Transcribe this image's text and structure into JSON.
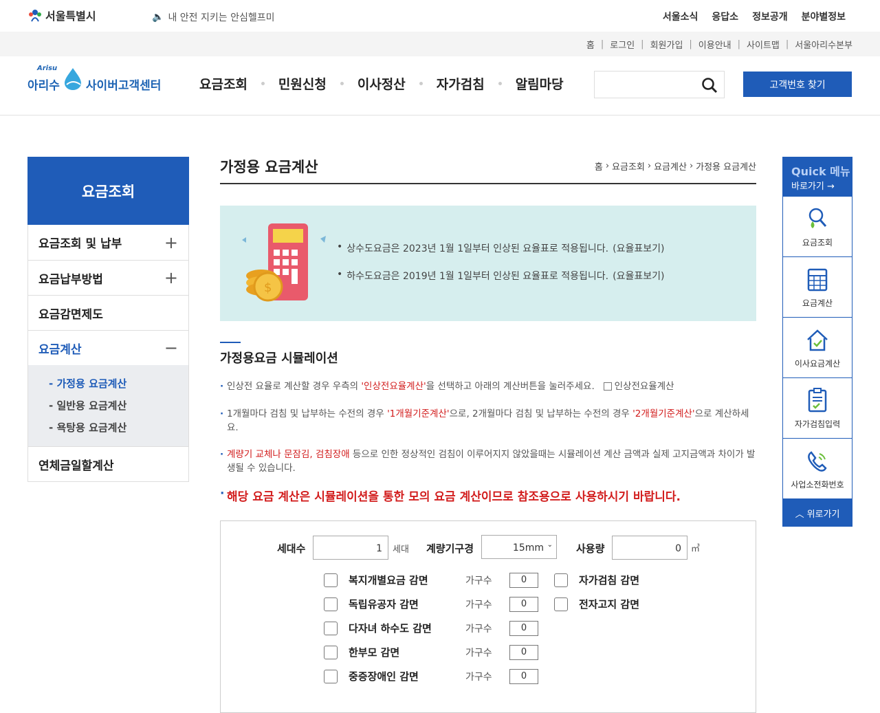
{
  "header": {
    "seoul_logo": "서울특별시",
    "slogan": "내 안전 지키는 안심헬프미",
    "top_nav": [
      "서울소식",
      "응답소",
      "정보공개",
      "분야별정보"
    ],
    "util_nav": [
      "홈",
      "로그인",
      "회원가입",
      "이용안내",
      "사이트맵",
      "서울아리수본부"
    ],
    "arisu_small": "Arisu",
    "arisu_name": "아리수",
    "arisu_center": "사이버고객센터",
    "gnb": [
      "요금조회",
      "민원신청",
      "이사정산",
      "자가검침",
      "알림마당"
    ],
    "search_placeholder": "",
    "find_button": "고객번호 찾기"
  },
  "lnb": {
    "title": "요금조회",
    "items": [
      {
        "label": "요금조회 및 납부",
        "toggle": "+"
      },
      {
        "label": "요금납부방법",
        "toggle": "+"
      },
      {
        "label": "요금감면제도",
        "toggle": ""
      },
      {
        "label": "요금계산",
        "toggle": "−"
      },
      {
        "label": "연체금일할계산",
        "toggle": ""
      }
    ],
    "sub_items": [
      "- 가정용 요금계산",
      "- 일반용 요금계산",
      "- 욕탕용 요금계산"
    ]
  },
  "content": {
    "title": "가정용 요금계산",
    "breadcrumb": [
      "홈",
      "요금조회",
      "요금계산",
      "가정용 요금계산"
    ],
    "notice_lines": [
      {
        "text": "상수도요금은 2023년 1월 1일부터 인상된 요율표로 적용됩니다.",
        "link": "(요율표보기)"
      },
      {
        "text": "하수도요금은 2019년 1월 1일부터 인상된 요율표로 적용됩니다.",
        "link": "(요율표보기)"
      }
    ],
    "section_title": "가정용요금 시뮬레이션",
    "desc1_a": "인상전 요율로 계산할 경우 우측의 ",
    "desc1_red": "'인상전요율계산'",
    "desc1_b": "을 선택하고 아래의 계산버튼을 눌러주세요.",
    "desc1_checkbox": "인상전요율계산",
    "desc2_a": "1개월마다 검침 및 납부하는 수전의 경우 ",
    "desc2_red1": "'1개월기준계산'",
    "desc2_b": "으로, 2개월마다 검침 및 납부하는 수전의 경우 ",
    "desc2_red2": "'2개월기준계산'",
    "desc2_c": "으로 계산하세요.",
    "desc3_red": "계량기 교체나 문잠김, 검침장애",
    "desc3_b": " 등으로 인한 정상적인 검침이 이루어지지 않았을때는 시뮬레이션 계산 금액과 실제 고지금액과 차이가 발생될 수 있습니다.",
    "warning": "해당 요금 계산은 시뮬레이션을 통한 모의 요금 계산이므로 참조용으로 사용하시기 바랍니다."
  },
  "form": {
    "household_label": "세대수",
    "household_value": "1",
    "household_unit": "세대",
    "meter_label": "계량기구경",
    "meter_value": "15mm",
    "usage_label": "사용량",
    "usage_value": "0",
    "usage_unit": "㎥",
    "count_label": "가구수",
    "discounts": [
      {
        "label": "복지개별요금 감면",
        "value": "0"
      },
      {
        "label": "독립유공자 감면",
        "value": "0"
      },
      {
        "label": "다자녀 하수도 감면",
        "value": "0"
      },
      {
        "label": "한부모 감면",
        "value": "0"
      },
      {
        "label": "중증장애인 감면",
        "value": "0"
      }
    ],
    "right_options": [
      "자가검침 감면",
      "전자고지 감면"
    ]
  },
  "quick": {
    "title": "Quick 메뉴",
    "subtitle": "바로가기",
    "items": [
      "요금조회",
      "요금계산",
      "이사요금계산",
      "자가검침입력",
      "사업소전화번호"
    ],
    "top": "위로가기"
  },
  "colors": {
    "primary": "#1f5cb8",
    "red": "#d21d1d",
    "notice_bg": "#d6eeee"
  }
}
